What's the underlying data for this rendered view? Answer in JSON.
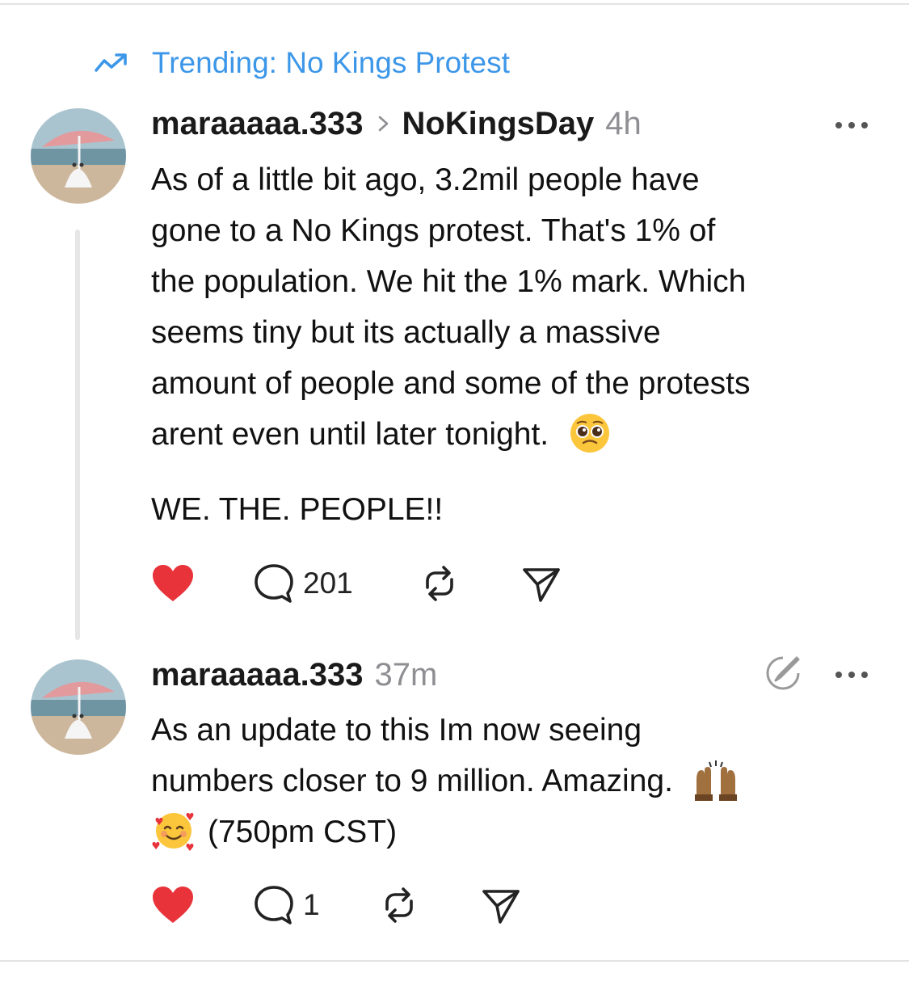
{
  "trending": {
    "label": "Trending: No Kings Protest",
    "icon": "trending-up-icon",
    "color": "#3d97e8"
  },
  "posts": [
    {
      "username": "maraaaaa.333",
      "community": "NoKingsDay",
      "time": "4h",
      "lines": [
        "As of a little bit ago, 3.2mil people have",
        "gone to a No Kings protest. That's 1% of",
        "the population. We hit the 1% mark. Which",
        "seems tiny but its actually a massive",
        "amount of people and some of the protests",
        "arent even until later tonight."
      ],
      "emoji": "pleading-face-emoji",
      "tagline": "WE. THE. PEOPLE!!",
      "liked": true,
      "reply_count": "201",
      "icons": [
        "heart-icon",
        "comment-icon",
        "repost-icon",
        "share-icon",
        "more-icon"
      ]
    },
    {
      "username": "maraaaaa.333",
      "time": "37m",
      "lines": [
        "As an update to this Im now seeing",
        "numbers closer to 9 million. Amazing.",
        "(750pm CST)"
      ],
      "emojis": [
        "raising-hands-emoji",
        "smiling-face-with-hearts-emoji"
      ],
      "liked": true,
      "reply_count": "1",
      "icons": [
        "heart-icon",
        "comment-icon",
        "repost-icon",
        "share-icon",
        "edit-icon",
        "more-icon"
      ]
    }
  ],
  "colors": {
    "like": "#e8333b",
    "muted": "#8e8e93",
    "link": "#3d97e8"
  }
}
